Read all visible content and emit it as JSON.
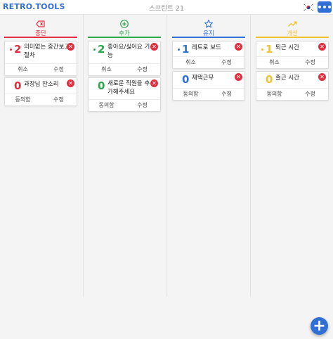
{
  "app": {
    "logo": "RETRO.TOOLS",
    "sprint_title": "스프린트 21",
    "language_flag": "korea-flag-icon",
    "menu_icon": "more-icon",
    "add_icon": "plus-icon"
  },
  "colors": {
    "stop": "#e03040",
    "add": "#2aa84a",
    "keep": "#2f6fd6",
    "improve": "#f2c230",
    "accent": "#2f6fd6"
  },
  "columns": [
    {
      "title": "중단",
      "icon": "backspace-icon",
      "cards": [
        {
          "score": "2",
          "text": "의미없는 중간보고 절차",
          "action_left": "취소",
          "action_right": "수정"
        },
        {
          "score": "0",
          "text": "과장님 잔소리",
          "action_left": "동의함",
          "action_right": "수정"
        }
      ]
    },
    {
      "title": "추가",
      "icon": "add-circle-icon",
      "cards": [
        {
          "score": "2",
          "text": "좋아요/싫어요 기능",
          "action_left": "취소",
          "action_right": "수정"
        },
        {
          "score": "0",
          "text": "새로운 직원을 추가해주세요",
          "action_left": "동의함",
          "action_right": "수정"
        }
      ]
    },
    {
      "title": "유지",
      "icon": "star-icon",
      "cards": [
        {
          "score": "1",
          "text": "레트로 보드",
          "action_left": "취소",
          "action_right": "수정"
        },
        {
          "score": "0",
          "text": "재택근무",
          "action_left": "동의함",
          "action_right": "수정"
        }
      ]
    },
    {
      "title": "개선",
      "icon": "trending-up-icon",
      "cards": [
        {
          "score": "1",
          "text": "퇴근 시간",
          "action_left": "취소",
          "action_right": "수정"
        },
        {
          "score": "0",
          "text": "출근 시간",
          "action_left": "동의함",
          "action_right": "수정"
        }
      ]
    }
  ]
}
